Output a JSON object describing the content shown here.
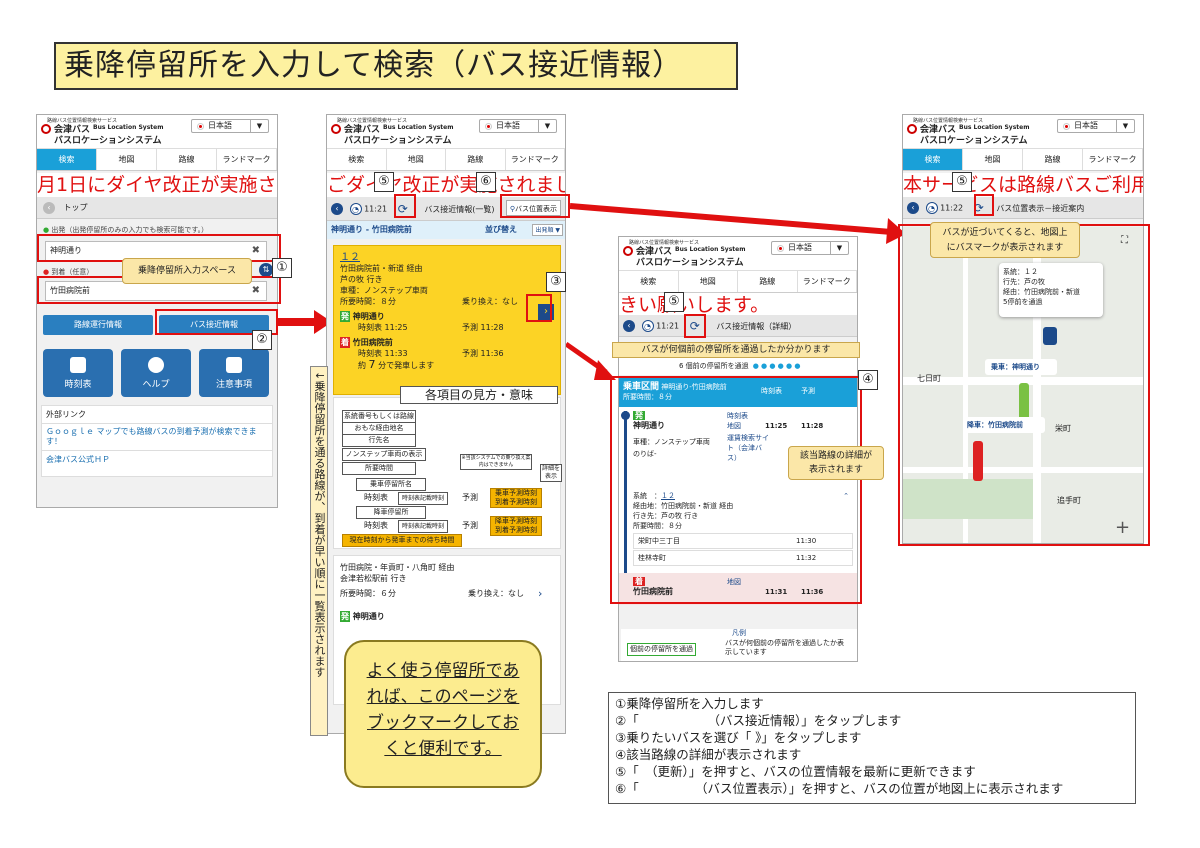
{
  "title": "乗降停留所を入力して検索（バス接近情報）",
  "app": {
    "service_small": "路線バス位置情報検索サービス",
    "brand1": "会津バス",
    "brand1_sub": "Bus Location System",
    "brand2": "バスロケーションシステム",
    "lang": "日本語",
    "lang_arrow": "▼",
    "tabs": [
      "検索",
      "地図",
      "路線",
      "ランドマーク"
    ]
  },
  "screen1": {
    "marquee": "月1日にダイヤ改正が実施されまし",
    "nav_top": "トップ",
    "dep_label": "出発（出発停留所のみの入力でも検索可能です。）",
    "dep_value": "神明通り",
    "arr_label": "到着（任意）",
    "arr_value": "竹田病院前",
    "clear": "✖",
    "swap": "⇅",
    "btn_route": "路線運行情報",
    "btn_approach": "バス接近情報",
    "big_buttons": [
      "時刻表",
      "ヘルプ",
      "注意事項"
    ],
    "ext_title": "外部リンク",
    "ext_link1": "Ｇｏｏｇｌｅ マップでも路線バスの到着予測が検索できます！",
    "ext_link2": "会津バス公式ＨＰ"
  },
  "screen2": {
    "marquee": "ごダイヤ改正が実施されましたので",
    "time": "11:21",
    "nav_title": "バス接近情報(一覧)",
    "map_btn": "バス位置表示",
    "route_header": "神明通り - 竹田病院前",
    "sort_label": "並び替え",
    "sort_value": "出発順 ▼",
    "card1": {
      "no": "１２",
      "via": "竹田病院前・新道 経由",
      "dest": "芦の牧 行き",
      "vehicle": "車種：ノンステップ車両",
      "duration": "所要時間：８分",
      "transfer": "乗り換え：なし",
      "board_mark": "発",
      "board_stop": "神明通り",
      "board_tt": "時刻表 11:25",
      "board_pred": "予測 11:28",
      "alight_mark": "着",
      "alight_stop": "竹田病院前",
      "alight_tt": "時刻表 11:33",
      "alight_pred": "予測 11:36",
      "wait": "約",
      "wait_min": "7",
      "wait_tail": "分で発車します"
    },
    "card2": {
      "via": "竹田病院・年貢町・八角町 経由",
      "dest": "会津若松駅前 行き",
      "duration": "所要時間：６分",
      "transfer": "乗り換え：なし",
      "board_stop": "神明通り"
    },
    "legend_title": "各項目の見方・意味",
    "legend": {
      "l1": "系統番号もしくは路線名",
      "l2": "おもな経由地名",
      "l3": "行先名",
      "l4": "ノンステップ車両の表示",
      "l5": "所要時間",
      "l6": "乗車停留所名",
      "l7": "時刻表",
      "l7b": "時刻表記載時刻",
      "l8": "降車停留所",
      "l9": "時刻表",
      "l9b": "時刻表記載時刻",
      "l10": "現在時刻から発車までの待ち時間",
      "pred": "予測",
      "o1": "乗車予測時刻\n到着予測時刻",
      "o2": "降車予測時刻\n到着予測時刻",
      "r1": "※当該システムでの乗り換え案内はできません",
      "r2": "詳細を表示"
    }
  },
  "screen3": {
    "marquee": "きい願いします。",
    "time": "11:21",
    "nav_title": "バス接近情報（詳細）",
    "passing": "6 個前の停留所を通過",
    "header_label": "乗車区間",
    "header_route": "神明通り-竹田病院前",
    "header_duration": "所要時間：８分",
    "col_tt": "時刻表",
    "col_pred": "予測",
    "dep_mark": "発",
    "dep_stop": "神明通り",
    "dep_tt": "11:25",
    "dep_pred": "11:28",
    "link_tt": "時刻表",
    "link_map": "地図",
    "link_search": "運賃検索サイト（会津バス）",
    "vehicle": "車種：ノンステップ車両",
    "nori": "のりば-",
    "sys_no": "系統　：",
    "sys_no_v": "１２",
    "sys_via": "経由地：竹田病院前・新道 経由",
    "sys_dest": "行き先：芦の牧 行き",
    "sys_dur": "所要時間：８分",
    "stops": [
      {
        "name": "栄町中三丁目",
        "time": "11:30"
      },
      {
        "name": "桂林寺町",
        "time": "11:32"
      }
    ],
    "arr_mark": "着",
    "arr_map": "地図",
    "arr_stop": "竹田病院前",
    "arr_tt": "11:31",
    "arr_pred": "11:36",
    "legend_title": "凡例",
    "legend_item": "個前の停留所を通過",
    "legend_desc": "バスが何個前の停留所を通過したか表示しています",
    "callout_top": "バスが何個前の停留所を通過したか分かります",
    "callout_detail": "該当路線の詳細が\n表示されます"
  },
  "screen4": {
    "marquee": "本サービスは路線バスご利用時の",
    "time": "11:22",
    "nav_title": "バス位置表示－接近案内",
    "callout": "バスが近づいてくると、地図上\nにバスマークが表示されます",
    "info_line1": "系統：１２",
    "info_line2": "行先：芦の牧",
    "info_line3": "経由：竹田病院前・新道",
    "info_line4": "5停前を通過",
    "board": "乗車：神明通り",
    "alight": "降車：竹田病院前",
    "place1": "七日町",
    "place2": "栄町",
    "place3": "追手町",
    "plus": "+"
  },
  "labels": {
    "n1": "①",
    "n2": "②",
    "n3": "③",
    "n4": "④",
    "n5": "⑤",
    "n6": "⑥",
    "input_space": "乗降停留所入力スペース"
  },
  "vertical": "↓乗降停留所を通る路線が、到着が早い順に一覧表示されます",
  "sticky": [
    "よく使う停留所であ",
    "れば、このページを",
    "ブックマークしてお",
    "くと便利です。"
  ],
  "notes": [
    "①乗降停留所を入力します",
    "②「　　　　　　（バス接近情報）」をタップします",
    "③乗りたいバスを選び「 》」をタップします",
    "④該当路線の詳細が表示されます",
    "⑤「　（更新）」を押すと、バスの位置情報を最新に更新できます",
    "⑥「　　　　　（バス位置表示）」を押すと、バスの位置が地図上に表示されます"
  ],
  "colors": {
    "accent": "#1aa0d8",
    "red": "#e01010",
    "yellow": "#f5c400",
    "navy": "#1c4a8a"
  }
}
